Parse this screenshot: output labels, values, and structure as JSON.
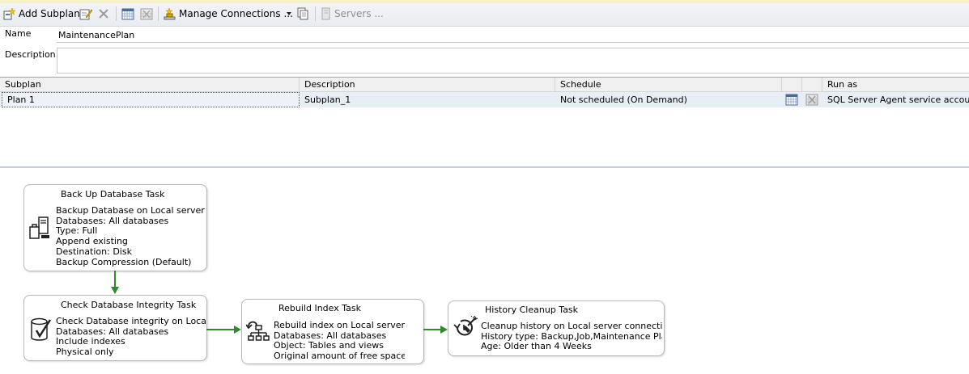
{
  "toolbar": {
    "add_subplan": "Add Subplan",
    "manage_connections": "Manage Connections ...",
    "servers": "Servers ..."
  },
  "plan": {
    "name_label": "Name",
    "name_value": "MaintenancePlan",
    "description_label": "Description",
    "description_value": ""
  },
  "subplan_grid": {
    "headers": [
      "Subplan",
      "Description",
      "Schedule",
      "",
      "",
      "Run as"
    ],
    "rows": [
      {
        "subplan": "Plan 1",
        "description": "Subplan_1",
        "schedule": "Not scheduled (On Demand)",
        "run_as": "SQL Server Agent service account"
      }
    ]
  },
  "tasks": {
    "backup": {
      "title": "Back Up Database Task",
      "lines": [
        "Backup Database on Local server c",
        "Databases: All databases",
        "Type: Full",
        "Append existing",
        "Destination: Disk",
        "Backup Compression (Default)"
      ]
    },
    "integrity": {
      "title": "Check Database Integrity Task",
      "lines": [
        "Check Database integrity on Local",
        "Databases: All databases",
        "Include indexes",
        "Physical only"
      ]
    },
    "rebuild": {
      "title": "Rebuild Index Task",
      "lines": [
        "Rebuild index on Local server conr",
        "Databases: All databases",
        "Object: Tables and views",
        "Original amount of free space"
      ]
    },
    "cleanup": {
      "title": "History Cleanup Task",
      "lines": [
        "Cleanup history on Local server connection",
        "History type: Backup,Job,Maintenance Plan",
        "Age: Older than 4 Weeks"
      ]
    }
  },
  "colors": {
    "connector": "#2e8b2e",
    "grid_selected_row": "#e8eef6"
  }
}
